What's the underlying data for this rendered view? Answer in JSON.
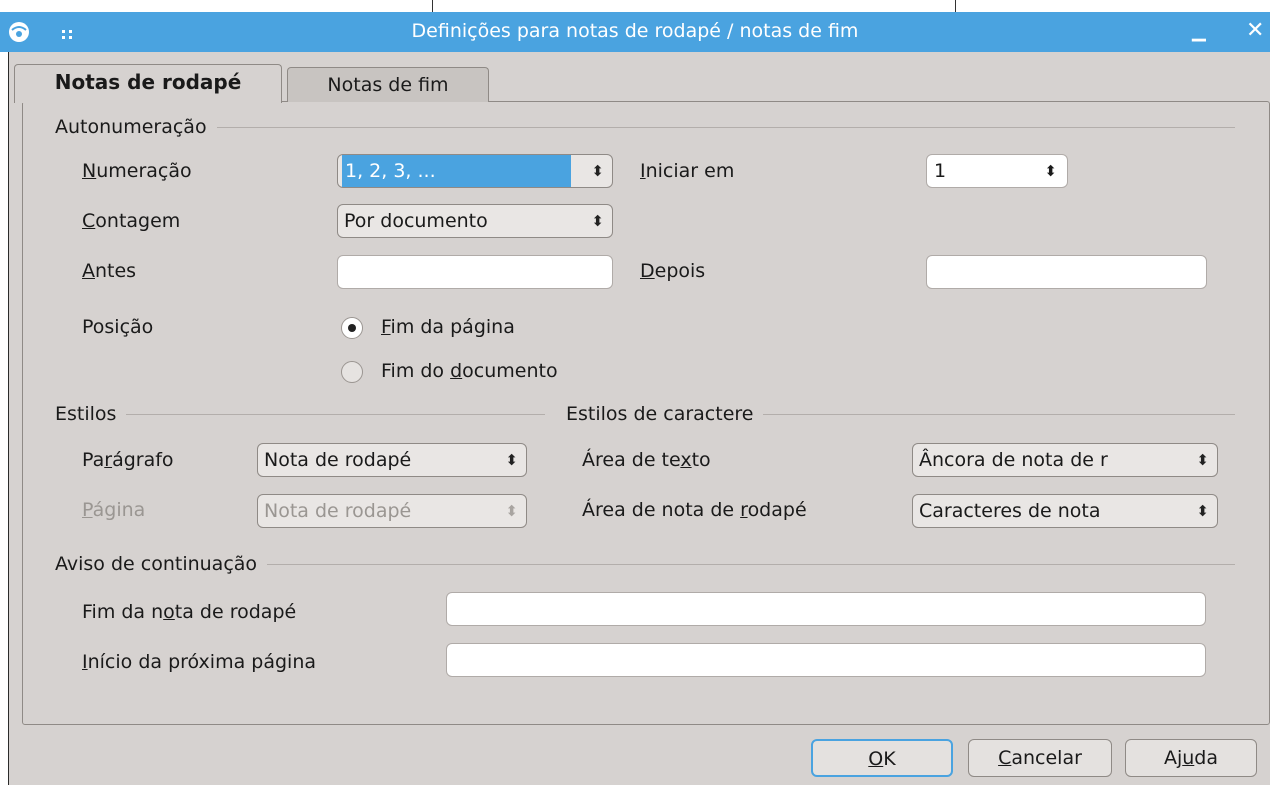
{
  "window": {
    "title": "Definições para notas de rodapé / notas de fim",
    "minimize_glyph": "▁",
    "close_glyph": "✕"
  },
  "tabs": [
    {
      "label": "Notas de rodapé",
      "active": true
    },
    {
      "label": "Notas de fim",
      "active": false
    }
  ],
  "autonumbering": {
    "header": "Autonumeração",
    "numbering": {
      "label_pre": "",
      "label_u": "N",
      "label_post": "umeração",
      "value": "1, 2, 3, ..."
    },
    "start_at": {
      "label_pre": "",
      "label_u": "I",
      "label_post": "niciar em",
      "value": "1"
    },
    "counting": {
      "label_pre": "",
      "label_u": "C",
      "label_post": "ontagem",
      "value": "Por documento"
    },
    "before": {
      "label_pre": "",
      "label_u": "A",
      "label_post": "ntes",
      "value": ""
    },
    "after": {
      "label_pre": "",
      "label_u": "D",
      "label_post": "epois",
      "value": ""
    },
    "position": {
      "label": "Posição",
      "option_page": {
        "pre": "",
        "u": "F",
        "post": "im da página",
        "selected": true
      },
      "option_doc": {
        "pre": "Fim do ",
        "u": "d",
        "post": "ocumento",
        "selected": false
      }
    }
  },
  "styles": {
    "header": "Estilos",
    "paragraph": {
      "label_pre": "Pa",
      "label_u": "r",
      "label_post": "ágrafo",
      "value": "Nota de rodapé"
    },
    "page": {
      "label_pre": "",
      "label_u": "P",
      "label_post": "ágina",
      "value": "Nota de rodapé",
      "disabled": true
    }
  },
  "char_styles": {
    "header": "Estilos de caractere",
    "text_area": {
      "label_pre": "Área de te",
      "label_u": "x",
      "label_post": "to",
      "value": "Âncora de nota de r"
    },
    "footnote_area": {
      "label_pre": "Área de nota de ",
      "label_u": "r",
      "label_post": "odapé",
      "value": "Caracteres de nota"
    }
  },
  "continuation": {
    "header": "Aviso de continuação",
    "end": {
      "label_pre": "Fim da n",
      "label_u": "o",
      "label_post": "ta de rodapé",
      "value": ""
    },
    "start": {
      "label_pre": "",
      "label_u": "I",
      "label_post": "nício da próxima página",
      "value": ""
    }
  },
  "buttons": {
    "ok": {
      "pre": "",
      "u": "O",
      "post": "K"
    },
    "cancel": {
      "pre": "",
      "u": "C",
      "post": "ancelar"
    },
    "help": {
      "pre": "Aj",
      "u": "u",
      "post": "da"
    }
  },
  "colors": {
    "accent": "#4aa3e0",
    "dialog_bg": "#d6d2d0"
  },
  "icons": {
    "app": "app-icon",
    "grip": "grip-icon",
    "spin": "up-down-arrows-icon"
  }
}
